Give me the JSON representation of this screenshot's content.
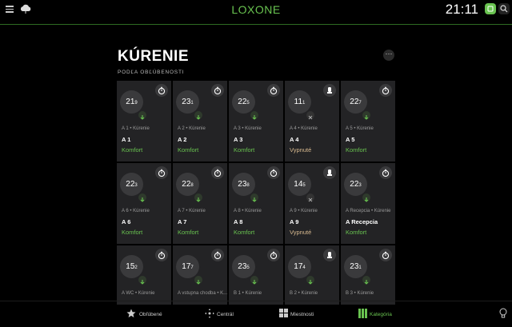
{
  "header": {
    "brand": "LOXONE",
    "time": "21:11"
  },
  "page": {
    "title": "KÚRENIE",
    "subtitle": "PODĽA OBĽÚBENOSTI",
    "more_label": "···"
  },
  "colors": {
    "accent": "#69c350",
    "tile_bg": "#232325",
    "status_off": "#d7b98f"
  },
  "tiles": [
    {
      "int": "21",
      "dec": "9",
      "sub": "A 1 • Kúrenie",
      "name": "A 1",
      "status": "Komfort",
      "icon": "stopwatch-icon"
    },
    {
      "int": "23",
      "dec": "1",
      "sub": "A 2 • Kúrenie",
      "name": "A 2",
      "status": "Komfort",
      "icon": "stopwatch-icon"
    },
    {
      "int": "22",
      "dec": "5",
      "sub": "A 3 • Kúrenie",
      "name": "A 3",
      "status": "Komfort",
      "icon": "stopwatch-icon"
    },
    {
      "int": "11",
      "dec": "1",
      "sub": "A 4 • Kúrenie",
      "name": "A 4",
      "status": "Vypnuté",
      "icon": "hand-icon"
    },
    {
      "int": "22",
      "dec": "7",
      "sub": "A 5 • Kúrenie",
      "name": "A 5",
      "status": "Komfort",
      "icon": "stopwatch-icon"
    },
    {
      "int": "22",
      "dec": "3",
      "sub": "A 6 • Kúrenie",
      "name": "A 6",
      "status": "Komfort",
      "icon": "stopwatch-icon"
    },
    {
      "int": "22",
      "dec": "8",
      "sub": "A 7 • Kúrenie",
      "name": "A 7",
      "status": "Komfort",
      "icon": "stopwatch-icon"
    },
    {
      "int": "23",
      "dec": "8",
      "sub": "A 8 • Kúrenie",
      "name": "A 8",
      "status": "Komfort",
      "icon": "stopwatch-icon"
    },
    {
      "int": "14",
      "dec": "5",
      "sub": "A 9 • Kúrenie",
      "name": "A 9",
      "status": "Vypnuté",
      "icon": "hand-icon"
    },
    {
      "int": "22",
      "dec": "3",
      "sub": "A Recepcia • Kúrenie",
      "name": "A Recepcia",
      "status": "Komfort",
      "icon": "stopwatch-icon"
    },
    {
      "int": "15",
      "dec": "2",
      "sub": "A WC • Kúrenie",
      "name": "",
      "status": "",
      "icon": "stopwatch-icon"
    },
    {
      "int": "17",
      "dec": "7",
      "sub": "A vstupna chodba • K...",
      "name": "",
      "status": "",
      "icon": "stopwatch-icon"
    },
    {
      "int": "23",
      "dec": "5",
      "sub": "B 1 • Kúrenie",
      "name": "",
      "status": "",
      "icon": "stopwatch-icon"
    },
    {
      "int": "17",
      "dec": "4",
      "sub": "B 2 • Kúrenie",
      "name": "",
      "status": "",
      "icon": "hand-icon"
    },
    {
      "int": "23",
      "dec": "1",
      "sub": "B 3 • Kúrenie",
      "name": "",
      "status": "",
      "icon": "stopwatch-icon"
    }
  ],
  "nav": {
    "favorites": "Obľúbené",
    "central": "Centrál",
    "rooms": "Miestnosti",
    "categories": "Kategória"
  }
}
